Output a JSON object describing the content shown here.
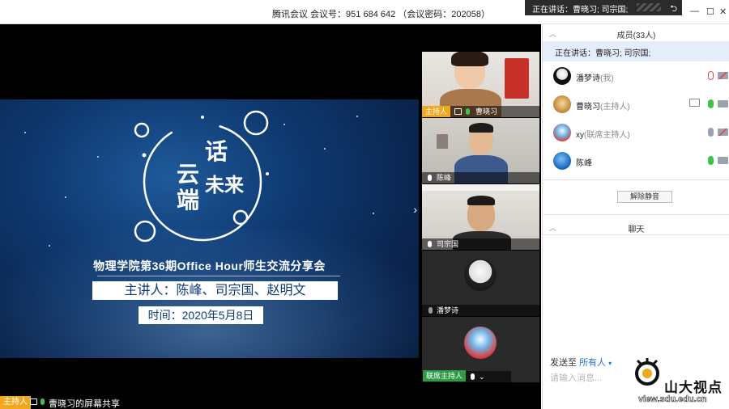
{
  "window": {
    "title": "腾讯会议 会议号：951 684 642 （会议密码：202058）",
    "speaking_popup": "正在讲话：曹晓习; 司宗国;",
    "controls": [
      "—",
      "☐",
      "✕"
    ]
  },
  "slide": {
    "logo_chars": [
      "云",
      "话",
      "端",
      "未来"
    ],
    "subtitle": "物理学院第36期Office Hour师生交流分享会",
    "presenters": "主讲人：陈峰、司宗国、赵明文",
    "date": "时间：2020年5月8日"
  },
  "screen_share": {
    "host_tag": "主持人",
    "label": "曹晓习的屏幕共享"
  },
  "thumbnails": [
    {
      "host_tag": "主持人",
      "name": "曹晓习"
    },
    {
      "name": "陈峰"
    },
    {
      "name": "司宗国"
    },
    {
      "name": "潘梦诗"
    },
    {
      "tag": "联席主持人"
    }
  ],
  "panel": {
    "members_header": "成员(33人)",
    "speaking": "正在讲话：曹晓习; 司宗国;",
    "members": [
      {
        "name": "潘梦诗",
        "role": "(我)",
        "mic": "off",
        "cam": "off"
      },
      {
        "name": "曹晓习",
        "role": "(主持人)",
        "mic": "on",
        "cam": "on",
        "share": true
      },
      {
        "name": "xy",
        "role": "(联席主持人)",
        "mic": "gray",
        "cam": "off"
      },
      {
        "name": "陈峰",
        "role": "",
        "mic": "on",
        "cam": "on"
      }
    ],
    "unmute_button": "解除静音",
    "chat_header": "聊天",
    "send_to_label": "发送至",
    "send_to_target": "所有人",
    "input_placeholder": "请输入消息..."
  },
  "watermark": {
    "name": "山大视点",
    "url": "view.sdu.edu.cn"
  },
  "colors": {
    "host_tag": "#f0a81f",
    "link_blue": "#2a6fd6",
    "mic_green": "#3ec34a",
    "highlight": "#e4eefb"
  }
}
